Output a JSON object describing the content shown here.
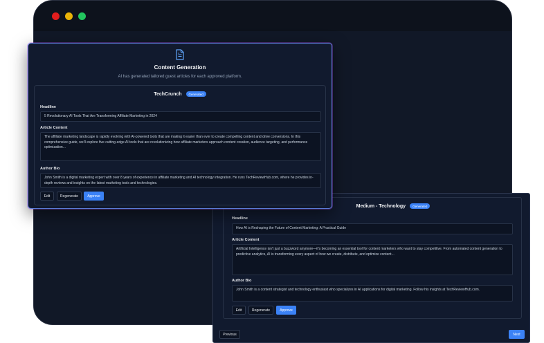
{
  "window": {
    "dots": [
      "#e11d1d",
      "#eab308",
      "#22c55e"
    ]
  },
  "front": {
    "title": "Content Generation",
    "subtitle": "AI has generated tailored guest articles for each approved platform.",
    "platform": "TechCrunch",
    "badge": "Generated",
    "headline_label": "Headline",
    "headline": "5 Revolutionary AI Tools That Are Transforming Affiliate Marketing in 2024",
    "article_label": "Article Content",
    "article": "The affiliate marketing landscape is rapidly evolving with AI-powered tools that are making it easier than ever to create compelling content and drive conversions. In this comprehensive guide, we'll explore five cutting-edge AI tools that are revolutionizing how affiliate marketers approach content creation, audience targeting, and performance optimization...",
    "bio_label": "Author Bio",
    "bio": "John Smith is a digital marketing expert with over 8 years of experience in affiliate marketing and AI technology integration. He runs TechReviewHub.com, where he provides in-depth reviews and insights on the latest marketing tools and technologies.",
    "edit": "Edit",
    "regenerate": "Regenerate",
    "approve": "Approve"
  },
  "back": {
    "platform": "Medium - Technology",
    "badge": "Generated",
    "headline_label": "Headline",
    "headline": "How AI is Reshaping the Future of Content Marketing: A Practical Guide",
    "article_label": "Article Content",
    "article": "Artificial Intelligence isn't just a buzzword anymore—it's becoming an essential tool for content marketers who want to stay competitive. From automated content generation to predictive analytics, AI is transforming every aspect of how we create, distribute, and optimize content...",
    "bio_label": "Author Bio",
    "bio": "John Smith is a content strategist and technology enthusiast who specializes in AI applications for digital marketing. Follow his insights at TechReviewHub.com.",
    "edit": "Edit",
    "regenerate": "Regenerate",
    "approve": "Approve",
    "previous": "Previous",
    "next": "Next"
  }
}
